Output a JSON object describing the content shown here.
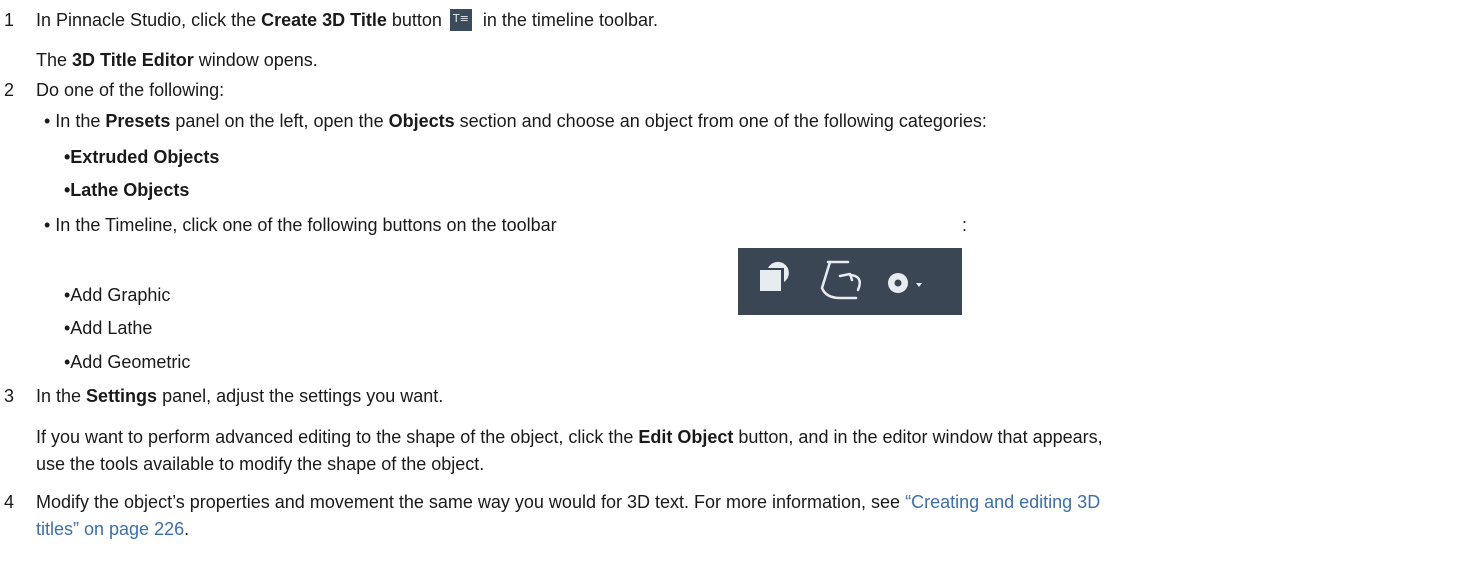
{
  "steps": [
    {
      "num": "1",
      "text_a": "In Pinnacle Studio, click the ",
      "b1": "Create 3D Title",
      "text_b": " button",
      "text_c": " in the timeline toolbar.",
      "result_a": "The ",
      "result_b": "3D Title Editor",
      "result_c": " window opens."
    },
    {
      "num": "2",
      "text": "Do one of the following:",
      "option1": {
        "a": "• In the ",
        "b1": "Presets",
        "c": " panel on the left, open the ",
        "b2": "Objects",
        "d": " section and choose an object from one of the following categories:",
        "items": [
          "•Extruded Objects",
          "•Lathe Objects"
        ]
      },
      "option2": {
        "text": "• In the Timeline, click one of the following buttons on the toolbar",
        "colon": ":",
        "items": [
          "•Add Graphic",
          "•Add Lathe",
          "•Add Geometric"
        ]
      }
    },
    {
      "num": "3",
      "a": "In the ",
      "b1": "Settings",
      "c": " panel, adjust the settings you want.",
      "p1a": "If you want to perform advanced editing to the shape of the object, click the ",
      "p1b": "Edit Object",
      "p1c": " button, and in the editor window that appears,",
      "p2": "use the tools available to modify the shape of the object."
    },
    {
      "num": "4",
      "a": "Modify the object’s properties and movement the same way you would for 3D text. For more information, see ",
      "link1": "“Creating and editing 3D",
      "link2": "titles” on page 226",
      "end": "."
    }
  ],
  "icons": {
    "title_icon_glyph": "T≡",
    "toolbar": [
      "graphic-icon",
      "lathe-icon",
      "geometric-icon",
      "dropdown-arrow-icon"
    ]
  },
  "colors": {
    "link": "#3d6fa8",
    "toolbar_bg": "#3a4654",
    "icon_fg": "#e8ecf0"
  }
}
